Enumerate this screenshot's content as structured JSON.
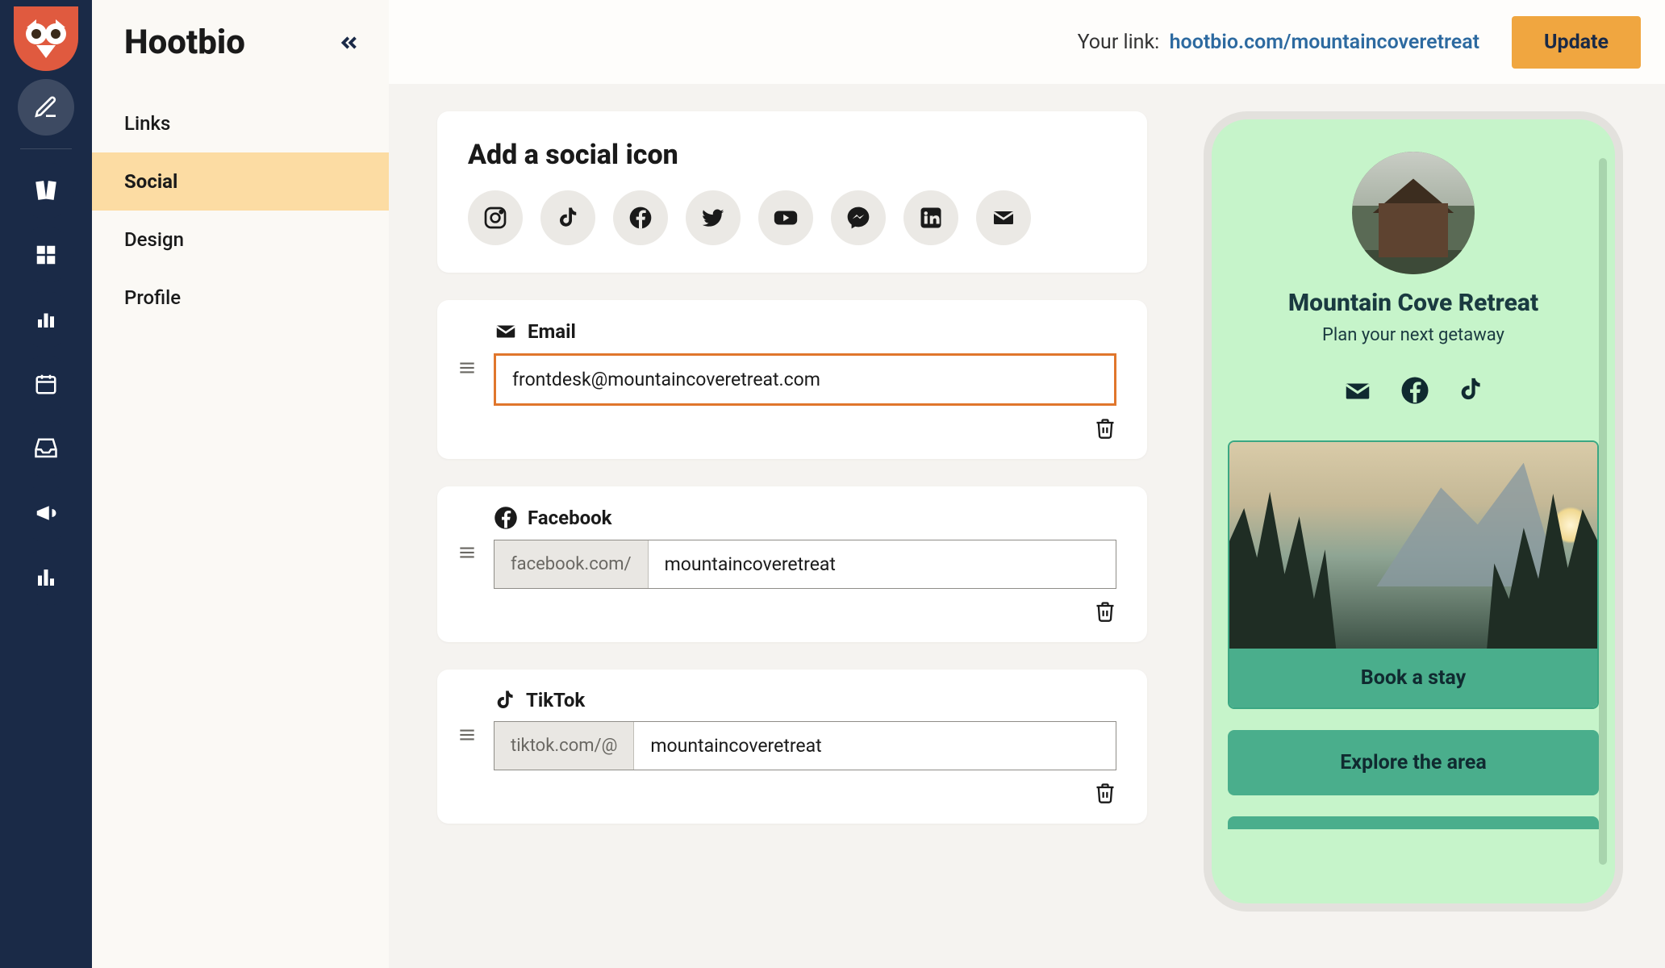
{
  "brand": "Hootbio",
  "sidebar": {
    "items": [
      {
        "label": "Links"
      },
      {
        "label": "Social"
      },
      {
        "label": "Design"
      },
      {
        "label": "Profile"
      }
    ],
    "active_index": 1
  },
  "topbar": {
    "your_link_label": "Your link:",
    "your_link_value": "hootbio.com/mountaincoveretreat",
    "update_label": "Update"
  },
  "editor": {
    "header": "Add a social icon",
    "palette": [
      "instagram-icon",
      "tiktok-icon",
      "facebook-icon",
      "twitter-icon",
      "youtube-icon",
      "messenger-icon",
      "linkedin-icon",
      "email-icon"
    ],
    "items": [
      {
        "icon": "email-icon",
        "label": "Email",
        "prefix": "",
        "value": "frontdesk@mountaincoveretreat.com",
        "highlight": true
      },
      {
        "icon": "facebook-icon",
        "label": "Facebook",
        "prefix": "facebook.com/",
        "value": "mountaincoveretreat",
        "highlight": false
      },
      {
        "icon": "tiktok-icon",
        "label": "TikTok",
        "prefix": "tiktok.com/@",
        "value": "mountaincoveretreat",
        "highlight": false
      }
    ]
  },
  "preview": {
    "title": "Mountain Cove Retreat",
    "subtitle": "Plan your next getaway",
    "social": [
      "email-icon",
      "facebook-icon",
      "tiktok-icon"
    ],
    "buttons": [
      "Book a stay",
      "Explore the area"
    ]
  }
}
